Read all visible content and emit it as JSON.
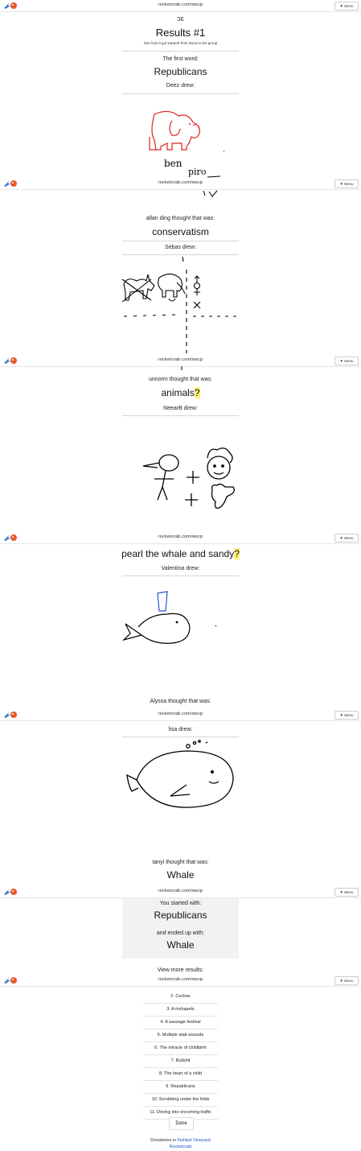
{
  "topbar": {
    "url": "rocketcrab.com/wscp",
    "menu_label": "▼ Menu"
  },
  "results": {
    "top_fragment": "ɔɛ",
    "title": "Results #1",
    "subtitle": "See how it got warped from wscp to the group",
    "first_word_label": "The first word:",
    "first_word": "Republicans"
  },
  "steps": [
    {
      "drew_label": "Deez drew:",
      "thought_label": "allan ding thought that was:",
      "thought": "conservatism"
    },
    {
      "drew_label": "Sebas drew:",
      "thought_label": "unnorm thought that was:",
      "thought": "animals",
      "thought_highlight": "?"
    },
    {
      "drew_label": "NeearB drew:",
      "thought_label": "",
      "thought": "pearl the whale and sandy",
      "thought_highlight": "?"
    },
    {
      "drew_label": "Valentina drew:",
      "thought_label": "Alyssa thought that was:",
      "thought": ""
    },
    {
      "drew_label": "lisa drew:",
      "thought_label": "tanyi thought that was:",
      "thought": "Whale"
    }
  ],
  "drawing_texts": {
    "ben": "ben",
    "piro": "piro"
  },
  "summary": {
    "started_label": "You started with:",
    "started_word": "Republicans",
    "ended_label": "and ended up with:",
    "ended_word": "Whale",
    "more_label": "View more results:"
  },
  "more_results": [
    "2. Cecline",
    "3. A mchapels",
    "4. A sausage festival",
    "5. Multiple stab wounds",
    "6. The miracle of childbirth",
    "7. Bullshit",
    "8. The heart of a child",
    "9. Republicans",
    "10. Scrubbing under the folds",
    "11. Driving into oncoming traffic"
  ],
  "done_label": "Done",
  "footer": {
    "line1_prefix": "Drewbetes is ",
    "line1_link": "Fishbot Vineyard",
    "line2_link": "Rocketcrab"
  },
  "colors": {
    "elephant": "#e02020",
    "hat": "#2a55d0",
    "highlight": "#fff176",
    "link": "#1a56c8"
  }
}
